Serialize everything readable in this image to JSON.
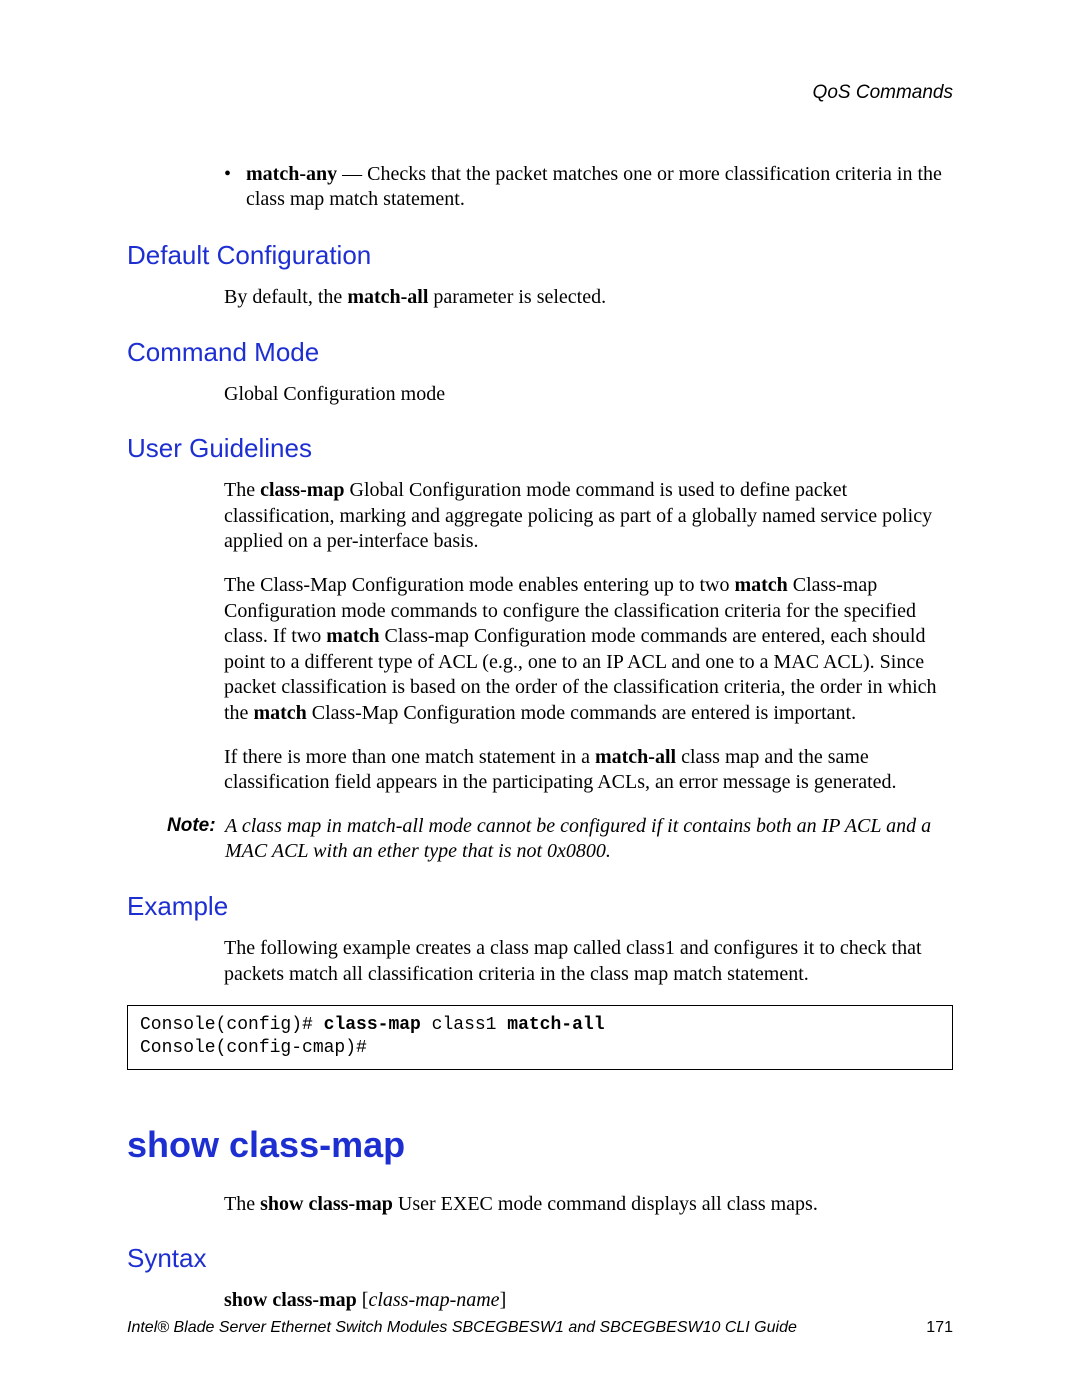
{
  "header": {
    "right": "QoS Commands"
  },
  "bullet": {
    "term": "match-any",
    "dash": " — ",
    "desc": "Checks that the packet matches one or more classification criteria in the class map match statement."
  },
  "sections": {
    "default_config": {
      "title": "Default Configuration",
      "p1_a": "By default, the ",
      "p1_b": "match-all",
      "p1_c": " parameter is selected."
    },
    "command_mode": {
      "title": "Command Mode",
      "p1": "Global Configuration mode"
    },
    "user_guidelines": {
      "title": "User Guidelines",
      "p1_a": "The ",
      "p1_b": "class-map",
      "p1_c": " Global Configuration mode command is used to define packet classification, marking and aggregate policing as part of a globally named service policy applied on a per-interface basis.",
      "p2_a": "The Class-Map Configuration mode enables entering up to two ",
      "p2_b": "match",
      "p2_c": " Class-map Configuration mode commands to configure the classification criteria for the specified class. If two ",
      "p2_d": "match",
      "p2_e": " Class-map Configuration mode commands are entered, each should point to a different type of ACL (e.g., one to an IP ACL and one to a MAC ACL). Since packet classification is based on the order of the classification criteria, the order in which the ",
      "p2_f": "match",
      "p2_g": " Class-Map Configuration mode commands are entered is important.",
      "p3_a": "If there is more than one match statement in a ",
      "p3_b": "match-all",
      "p3_c": " class map and the same classification field appears in the participating ACLs, an error message is generated."
    },
    "note": {
      "label": "Note:",
      "body": "A class map in match-all mode cannot be configured if it contains both an IP ACL and a MAC ACL with an ether type that is not 0x0800."
    },
    "example": {
      "title": "Example",
      "p1": "The following example creates a class map called class1 and configures it to check that packets match all classification criteria in the class map match statement.",
      "code": {
        "l1_a": "Console(config)# ",
        "l1_b": "class-map",
        "l1_c": " class1 ",
        "l1_d": "match-all",
        "l2": "Console(config-cmap)#"
      }
    },
    "show_class_map": {
      "title": "show class-map",
      "p1_a": "The ",
      "p1_b": "show class-map",
      "p1_c": " User EXEC mode command displays all class maps."
    },
    "syntax": {
      "title": "Syntax",
      "p1_a": "show class-map ",
      "p1_b": "[",
      "p1_c": "class-map-name",
      "p1_d": "]"
    }
  },
  "footer": {
    "left": "Intel® Blade Server Ethernet Switch Modules SBCEGBESW1 and SBCEGBESW10 CLI Guide",
    "page": "171"
  }
}
